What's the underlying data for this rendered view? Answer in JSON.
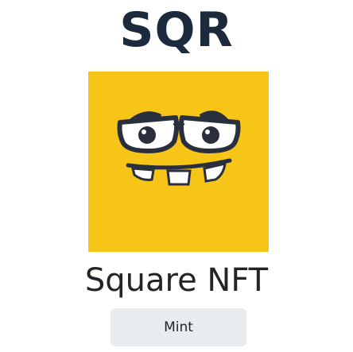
{
  "header": {
    "logo_text": "SQR"
  },
  "nft": {
    "image_icon": "yellow-face-glasses-nft-image",
    "title": "Square NFT",
    "background_color": "#f6c517"
  },
  "actions": {
    "mint_label": "Mint"
  }
}
